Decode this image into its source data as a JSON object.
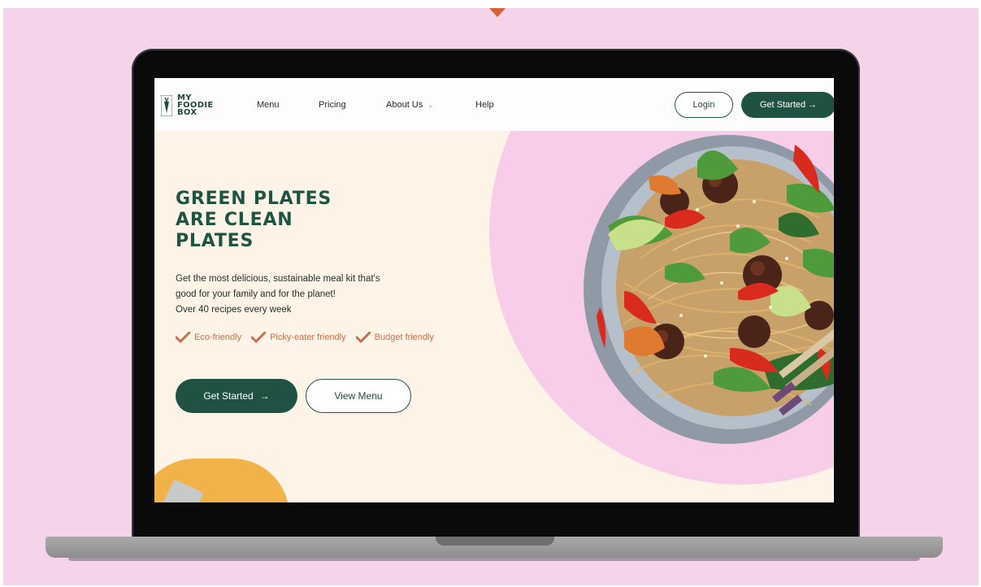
{
  "nav": {
    "logo": [
      "MY",
      "FOODIE",
      "BOX"
    ],
    "links": [
      "Menu",
      "Pricing",
      "About Us",
      "Help"
    ],
    "login_label": "Login",
    "get_started_label": "Get Started",
    "get_started_arrow": "→"
  },
  "hero": {
    "title_lines": [
      "GREEN PLATES",
      "ARE CLEAN",
      "PLATES"
    ],
    "description_lines": [
      "Get the most delicious, sustainable meal kit that's",
      "good for your family and for the planet!",
      "Over 40 recipes every week"
    ],
    "features": [
      "Eco-friendly",
      "Picky-eater friendly",
      "Budget friendly"
    ],
    "get_started_label": "Get Started",
    "get_started_arrow": "→",
    "view_menu_label": "View Menu"
  },
  "colors": {
    "brand_green": "#1f5242",
    "accent_orange": "#c96f4a",
    "background_pink": "#f5d3ea",
    "hero_cream": "#fdf3e7"
  }
}
